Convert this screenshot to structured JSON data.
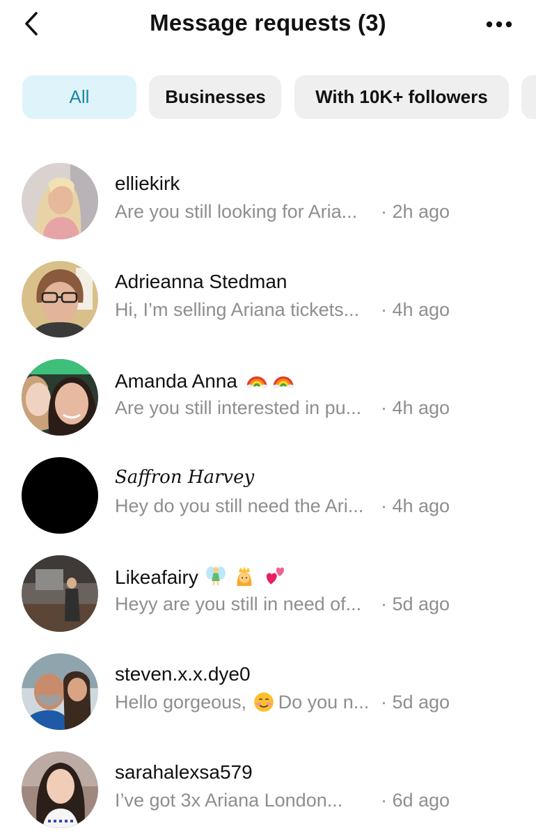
{
  "header": {
    "title": "Message requests (3)",
    "back_icon": "chevron-left-icon",
    "more_icon": "more-horizontal-icon"
  },
  "tabs": [
    {
      "label": "All",
      "active": true
    },
    {
      "label": "Businesses",
      "active": false
    },
    {
      "label": "With 10K+ followers",
      "active": false
    }
  ],
  "requests": [
    {
      "name": "elliekirk",
      "preview": "Are you still looking for Aria...",
      "time": "· 2h ago",
      "name_emoji": []
    },
    {
      "name": "Adrieanna Stedman",
      "preview": "Hi, I’m selling Ariana tickets...",
      "time": "· 4h ago",
      "name_emoji": []
    },
    {
      "name": "Amanda Anna",
      "preview": "Are you still interested in pu...",
      "time": "· 4h ago",
      "name_emoji": [
        "rainbow-emoji",
        "rainbow-emoji"
      ]
    },
    {
      "name": "Saffron Harvey",
      "preview": "Hey do you still need the Ari...",
      "time": "· 4h ago",
      "name_emoji": []
    },
    {
      "name": "Likeafairy",
      "preview": "Heyy are you still in need of...",
      "time": "· 5d ago",
      "name_emoji": [
        "fairy-emoji",
        "princess-emoji",
        "two-hearts-emoji"
      ]
    },
    {
      "name": "steven.x.x.dye0",
      "preview": "Hello gorgeous,",
      "preview_tail": "Do you n...",
      "time": "· 5d ago",
      "name_emoji": [],
      "preview_emoji": "smiling-face-emoji"
    },
    {
      "name": "sarahalexsa579",
      "preview": "I’ve got 3x Ariana London...",
      "time": "· 6d ago",
      "name_emoji": []
    }
  ],
  "colors": {
    "accent_tab_bg": "#dff3fb",
    "accent_tab_text": "#1a86a6",
    "secondary_text": "#8e8e8e",
    "tab_bg": "#efefef"
  }
}
